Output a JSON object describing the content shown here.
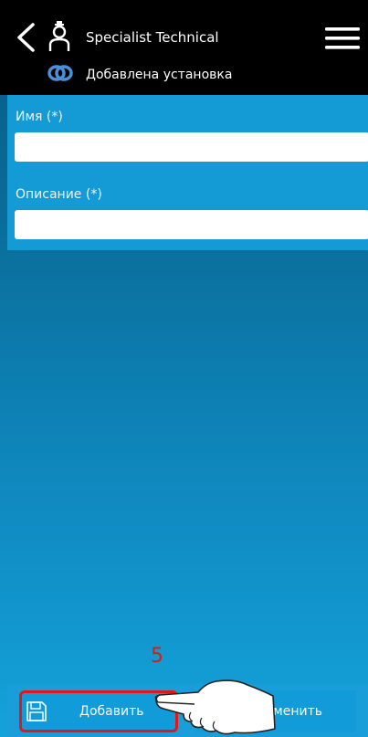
{
  "header": {
    "title": "Specialist Technical",
    "subtitle": "Добавлена установка"
  },
  "form": {
    "name_label": "Имя (*)",
    "name_value": "",
    "description_label": "Описание (*)",
    "description_value": ""
  },
  "actions": {
    "add_label": "Добавить",
    "cancel_label": "Отменить"
  },
  "annotation": {
    "step": "5"
  },
  "icons": {
    "back": "chevron-left",
    "user": "user-icon",
    "menu": "hamburger-menu",
    "link": "link-chain",
    "save": "floppy-disk",
    "pointer": "hand-pointer"
  },
  "colors": {
    "header_bg": "#000000",
    "panel_bg": "#149bd6",
    "accent_red": "#e01818",
    "link_icon": "#4a90d9"
  }
}
